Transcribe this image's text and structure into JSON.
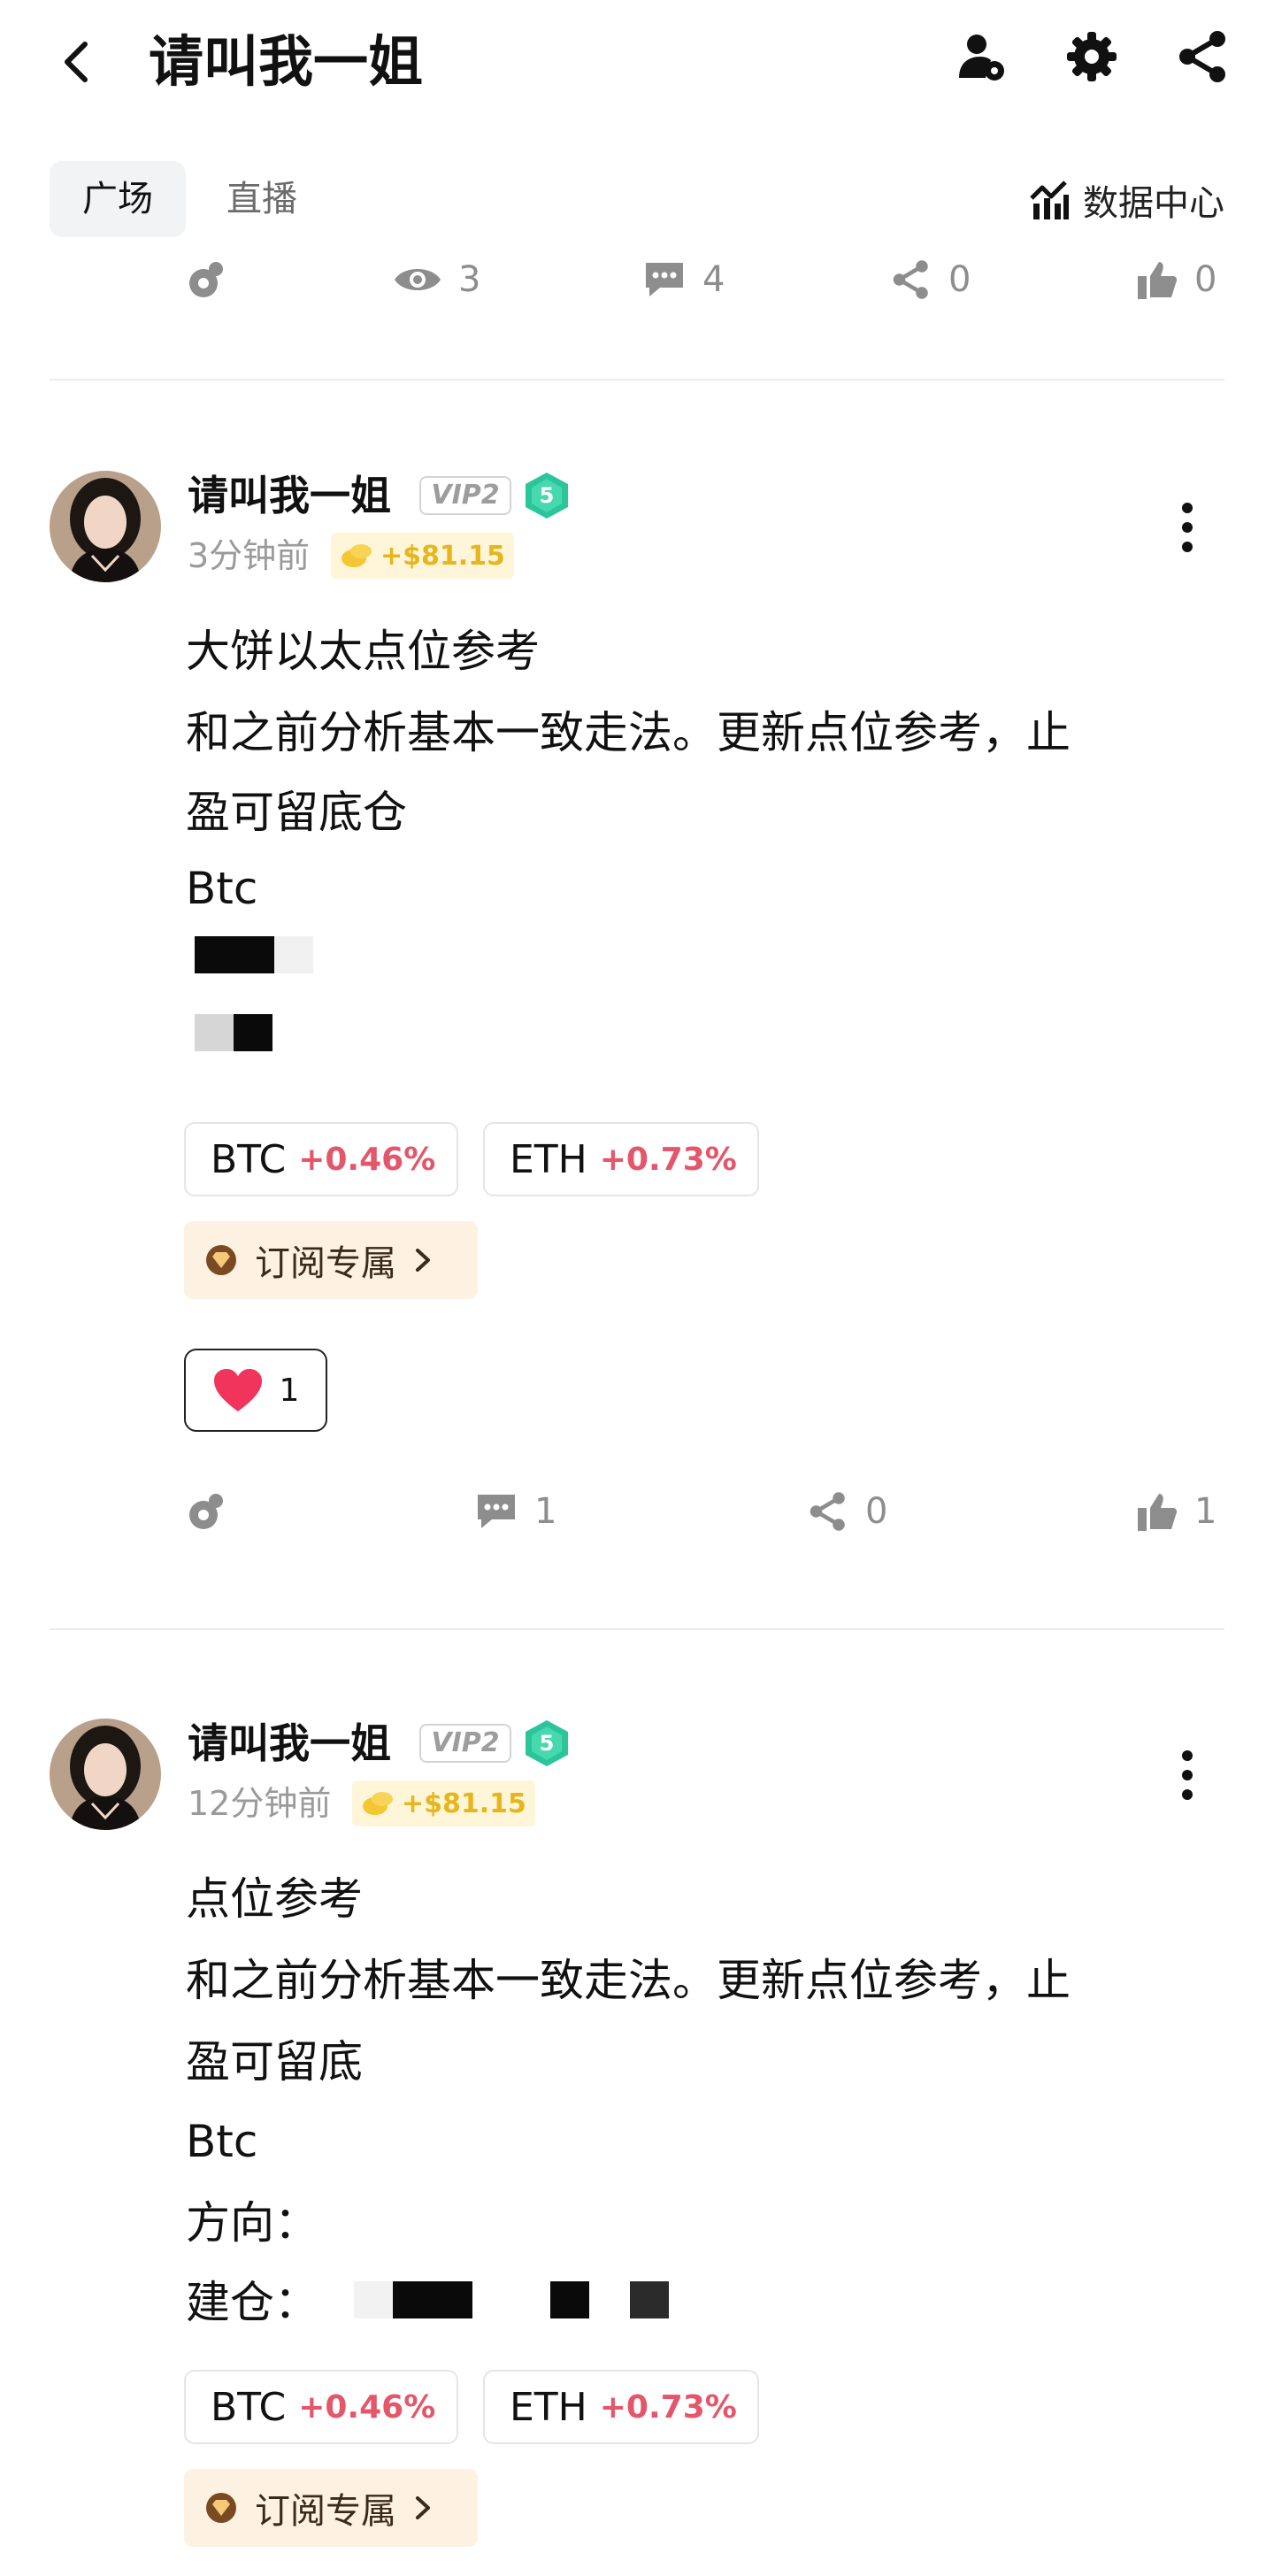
{
  "header": {
    "title": "请叫我一姐"
  },
  "tabs": [
    {
      "label": "广场",
      "active": true
    },
    {
      "label": "直播",
      "active": false
    }
  ],
  "data_center_label": "数据中心",
  "top_stats": {
    "views": "3",
    "comments": "4",
    "shares": "0",
    "likes": "0"
  },
  "posts": [
    {
      "author": "请叫我一姐",
      "vip": "VIP2",
      "level": "5",
      "time": "3分钟前",
      "profit": "+$81.15",
      "lines": [
        "大饼以太点位参考",
        "和之前分析基本一致走法。更新点位参考，止",
        "盈可留底仓",
        "Btc"
      ],
      "tickers": [
        {
          "symbol": "BTC",
          "change": "+0.46%"
        },
        {
          "symbol": "ETH",
          "change": "+0.73%"
        }
      ],
      "subscribe_label": "订阅专属",
      "reaction_count": "1",
      "stats": {
        "comments": "1",
        "shares": "0",
        "likes": "1"
      }
    },
    {
      "author": "请叫我一姐",
      "vip": "VIP2",
      "level": "5",
      "time": "12分钟前",
      "profit": "+$81.15",
      "lines": [
        "点位参考",
        "和之前分析基本一致走法。更新点位参考，止",
        "盈可留底",
        "Btc",
        "方向：",
        "建仓："
      ],
      "tickers": [
        {
          "symbol": "BTC",
          "change": "+0.46%"
        },
        {
          "symbol": "ETH",
          "change": "+0.73%"
        }
      ],
      "subscribe_label": "订阅专属"
    }
  ],
  "colors": {
    "accent_red": "#e4566a",
    "profit_gold": "#e7b51c",
    "level_badge": "#2bc59b"
  },
  "icons": [
    "back-arrow-icon",
    "user-settings-icon",
    "gear-icon",
    "share-icon",
    "chart-icon",
    "coin-icon",
    "eye-icon",
    "comment-icon",
    "like-icon",
    "heart-icon",
    "diamond-icon",
    "chevron-right-icon",
    "more-vertical-icon"
  ]
}
